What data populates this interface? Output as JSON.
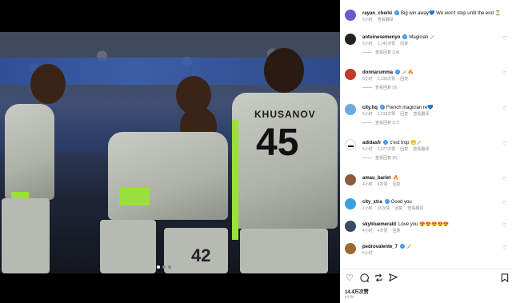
{
  "post": {
    "likes": "14.4万次赞",
    "time": "5小时"
  },
  "photo": {
    "jersey_name": "KHUSANOV",
    "jersey_number": "45",
    "shorts_number": "42"
  },
  "comments": [
    {
      "user": "rayan_cherki",
      "verified": true,
      "text": "Big win away💙 We won't stop until the end ⏳",
      "time": "5小时",
      "likes": "",
      "reply": "",
      "translate": "查看翻译",
      "replies_link": "",
      "avatar_color": "#6a5acd"
    },
    {
      "user": "antoinesemenyo",
      "verified": true,
      "text": "Magician 🪄",
      "time": "5小时",
      "likes": "1,742次赞",
      "reply": "回复",
      "translate": "",
      "replies_link": "查看回复 (14)",
      "avatar_color": "#222222"
    },
    {
      "user": "donnarumma",
      "verified": true,
      "text": "🪄🔥",
      "time": "5小时",
      "likes": "2,236次赞",
      "reply": "回复",
      "translate": "",
      "replies_link": "查看回复 (9)",
      "avatar_color": "#c0392b"
    },
    {
      "user": "city.hq",
      "verified": true,
      "text": "French magician re💙",
      "time": "5小时",
      "likes": "1,015次赞",
      "reply": "回复",
      "translate": "查看翻译",
      "replies_link": "查看回复 (17)",
      "avatar_color": "#6cabdd"
    },
    {
      "user": "adidasfr",
      "verified": true,
      "text": "c'est trop 😁🪄",
      "time": "5小时",
      "likes": "1,077次赞",
      "reply": "回复",
      "translate": "查看翻译",
      "replies_link": "查看回复 (5)",
      "avatar_color": "#000000"
    },
    {
      "user": "amau_barlet",
      "verified": false,
      "text": "🔥",
      "time": "4小时",
      "likes": "4次赞",
      "reply": "回复",
      "translate": "",
      "replies_link": "",
      "avatar_color": "#8e5a3c"
    },
    {
      "user": "city_xtra",
      "verified": true,
      "text": "Good you",
      "time": "1小时",
      "likes": "35次赞",
      "reply": "回复",
      "translate": "查看翻译",
      "replies_link": "",
      "avatar_color": "#3aa0e6"
    },
    {
      "user": "skybluemerald",
      "verified": false,
      "text": "Love you 😍😍😍😍😍",
      "time": "4小时",
      "likes": "4次赞",
      "reply": "回复",
      "translate": "",
      "replies_link": "",
      "avatar_color": "#3b4a63"
    },
    {
      "user": "pedrovalente_7",
      "verified": true,
      "text": "🪄",
      "time": "5小时",
      "likes": "",
      "reply": "",
      "translate": "",
      "replies_link": "",
      "avatar_color": "#9c6b2f"
    }
  ],
  "icons": {
    "like": "heart-icon",
    "comment": "comment-icon",
    "repost": "repost-icon",
    "share": "share-icon",
    "save": "bookmark-icon"
  }
}
